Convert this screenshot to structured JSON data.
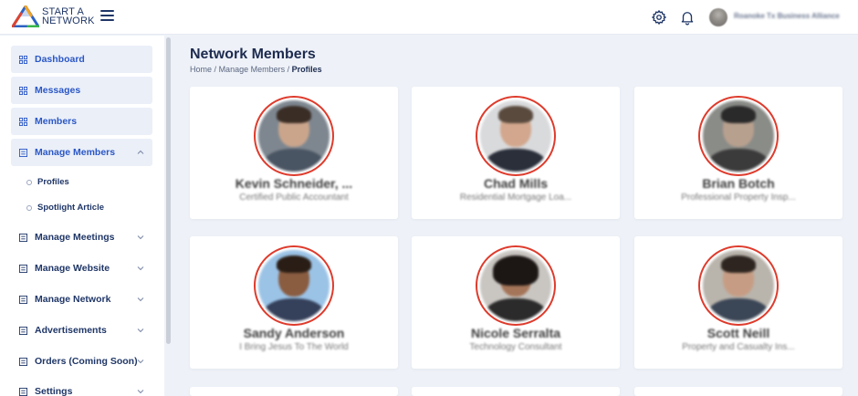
{
  "header": {
    "logo_line1": "START A",
    "logo_line2": "NETWORK",
    "org_name": "Roanoke Tx Business Alliance",
    "icons": [
      "gear-icon",
      "bell-icon"
    ]
  },
  "sidebar": {
    "items": [
      {
        "label": "Dashboard",
        "icon": "grid-icon"
      },
      {
        "label": "Messages",
        "icon": "grid-icon"
      },
      {
        "label": "Members",
        "icon": "grid-icon"
      },
      {
        "label": "Manage Members",
        "icon": "list-icon",
        "expanded": true
      },
      {
        "label": "Manage Meetings",
        "icon": "list-icon"
      },
      {
        "label": "Manage Website",
        "icon": "list-icon"
      },
      {
        "label": "Manage Network",
        "icon": "list-icon"
      },
      {
        "label": "Advertisements",
        "icon": "list-icon"
      },
      {
        "label": "Orders (Coming Soon)",
        "icon": "list-icon"
      },
      {
        "label": "Settings",
        "icon": "list-icon"
      }
    ],
    "sub_items": [
      "Profiles",
      "Spotlight Article"
    ]
  },
  "page": {
    "title": "Network Members",
    "breadcrumb": [
      "Home",
      "Manage Members",
      "Profiles"
    ],
    "breadcrumb_sep": "/"
  },
  "members": [
    {
      "name": "Kevin Schneider, ...",
      "role": "Certified Public Accountant"
    },
    {
      "name": "Chad Mills",
      "role": "Residential Mortgage Loa..."
    },
    {
      "name": "Brian Botch",
      "role": "Professional Property Insp..."
    },
    {
      "name": "Sandy Anderson",
      "role": "I Bring Jesus To The World"
    },
    {
      "name": "Nicole Serralta",
      "role": "Technology Consultant"
    },
    {
      "name": "Scott Neill",
      "role": "Property and Casualty Ins..."
    }
  ],
  "colors": {
    "accent": "#2b57c5",
    "navy": "#1f3667",
    "photo_ring": "#de3b2c",
    "background": "#eef2f8"
  }
}
